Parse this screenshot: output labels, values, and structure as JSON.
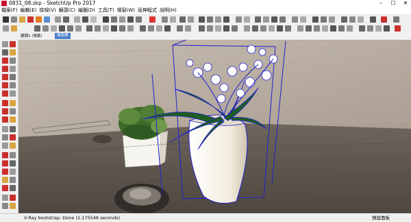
{
  "window": {
    "title": "0831_08.skp - SketchUp Pro 2017",
    "minimize": "–",
    "maximize": "☐",
    "close": "✕"
  },
  "menu": [
    "檔案(F)",
    "編輯(E)",
    "檢視(V)",
    "鏡頭(C)",
    "繪圖(D)",
    "工具(T)",
    "視窗(W)",
    "延伸程式",
    "說明(H)"
  ],
  "scene": {
    "label": "鏡頭1 (場景)",
    "active_tab": "場景開"
  },
  "status": {
    "message": "V-Ray bootstrap: Done (2.175548 seconds)",
    "tray": "預設面板"
  },
  "colors": {
    "accent": "#4a7ec8",
    "selection": "#1f1fd0",
    "leaf": "#1f5c22",
    "vase": "#f3efe2"
  }
}
